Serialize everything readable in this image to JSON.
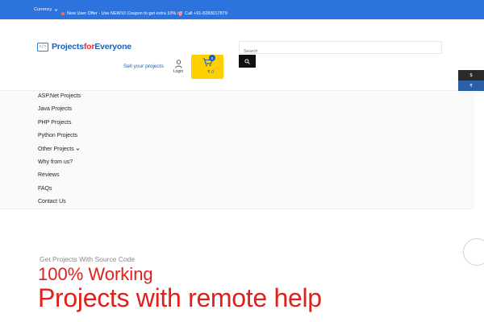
{
  "topbar": {
    "currency_label": "Currency",
    "offer_text": "New User Offer - Use NEW10 Coupon to get extra 10% off",
    "call_text": "Call +91-8283017879"
  },
  "logo": {
    "part1": "Projects",
    "part2": "for",
    "part3": "Everyone",
    "mark": "</>"
  },
  "search": {
    "placeholder": "Search"
  },
  "header": {
    "sell_label": "Sell your projects",
    "login_label": "Login",
    "cart_count": "0",
    "cart_total": "₹ 0"
  },
  "nav": {
    "items": [
      {
        "label": "ASP.Net Projects"
      },
      {
        "label": "Java Projects"
      },
      {
        "label": "PHP Projects"
      },
      {
        "label": "Python Projects"
      },
      {
        "label": "Other Projects"
      },
      {
        "label": "Why from us?"
      },
      {
        "label": "Reviews"
      },
      {
        "label": "FAQs"
      },
      {
        "label": "Contact Us"
      }
    ]
  },
  "currency_switch": {
    "usd": "$",
    "inr": "₹"
  },
  "hero": {
    "subtitle": "Get Projects With Source Code",
    "line1": "100% Working",
    "line2": "Projects with remote help"
  },
  "colors": {
    "topbar": "#2d73dd",
    "accent_red": "#e0211b",
    "cart": "#ffd000",
    "brand_blue": "#1e5fb8"
  }
}
